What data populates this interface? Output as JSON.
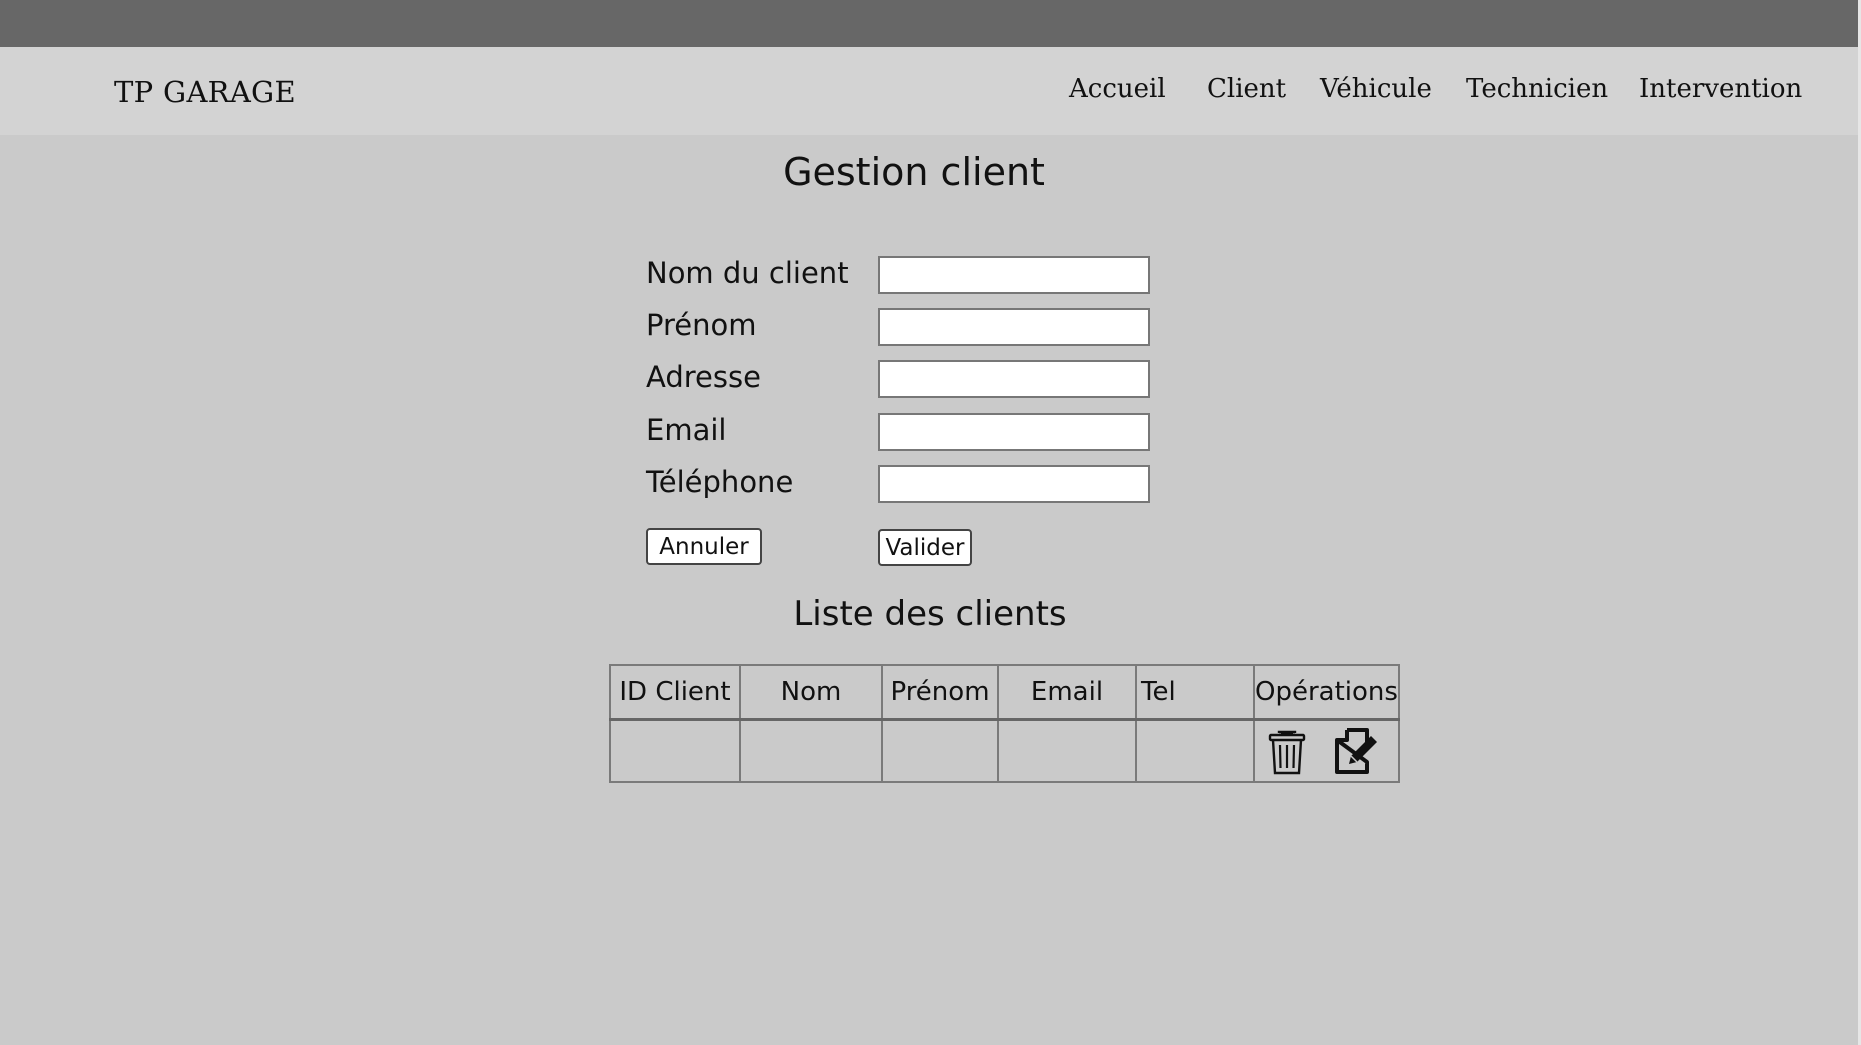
{
  "navbar": {
    "brand": "TP GARAGE",
    "links": [
      "Accueil",
      "Client",
      "Véhicule",
      "Technicien",
      "Intervention"
    ]
  },
  "page_title": "Gestion client",
  "form": {
    "fields": [
      {
        "label": "Nom du client",
        "value": ""
      },
      {
        "label": "Prénom",
        "value": ""
      },
      {
        "label": "Adresse",
        "value": ""
      },
      {
        "label": "Email",
        "value": ""
      },
      {
        "label": "Téléphone",
        "value": ""
      }
    ],
    "cancel_label": "Annuler",
    "submit_label": "Valider"
  },
  "list": {
    "title": "Liste des clients",
    "columns": [
      "ID Client",
      "Nom",
      "Prénom",
      "Email",
      "Tel",
      "Opérations"
    ],
    "rows": [
      {
        "cells": [
          "",
          "",
          "",
          "",
          ""
        ],
        "operations": [
          "trash-icon",
          "edit-document-icon"
        ]
      }
    ]
  },
  "colors": {
    "top_strip": "#676767",
    "navbar": "#d3d3d3",
    "background": "#cacaca"
  }
}
